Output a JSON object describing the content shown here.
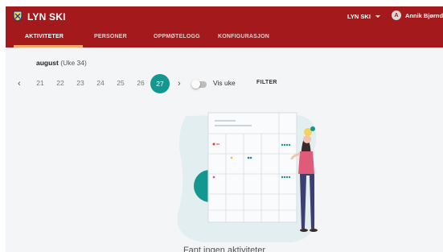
{
  "header": {
    "app_title": "LYN SKI",
    "club_menu_label": "LYN SKI",
    "user_initial": "A",
    "user_name": "Annik Bjørnda"
  },
  "tabs": [
    {
      "label": "AKTIVITETER",
      "active": true
    },
    {
      "label": "PERSONER",
      "active": false
    },
    {
      "label": "OPPMØTELOGG",
      "active": false
    },
    {
      "label": "KONFIGURASJON",
      "active": false
    }
  ],
  "calendar": {
    "month": "august",
    "week_label": "(Uke 34)",
    "days": [
      "21",
      "22",
      "23",
      "24",
      "25",
      "26",
      "27"
    ],
    "selected_day": "27",
    "prev_icon": "‹",
    "next_icon": "›"
  },
  "controls": {
    "vis_uke_label": "Vis uke",
    "vis_uke_on": false,
    "filter_label": "FILTER"
  },
  "empty_state": {
    "message": "Fant ingen aktiviteter"
  },
  "colors": {
    "primary": "#a3191c",
    "accent": "#13978e",
    "tab_indicator": "#f2a86b"
  }
}
